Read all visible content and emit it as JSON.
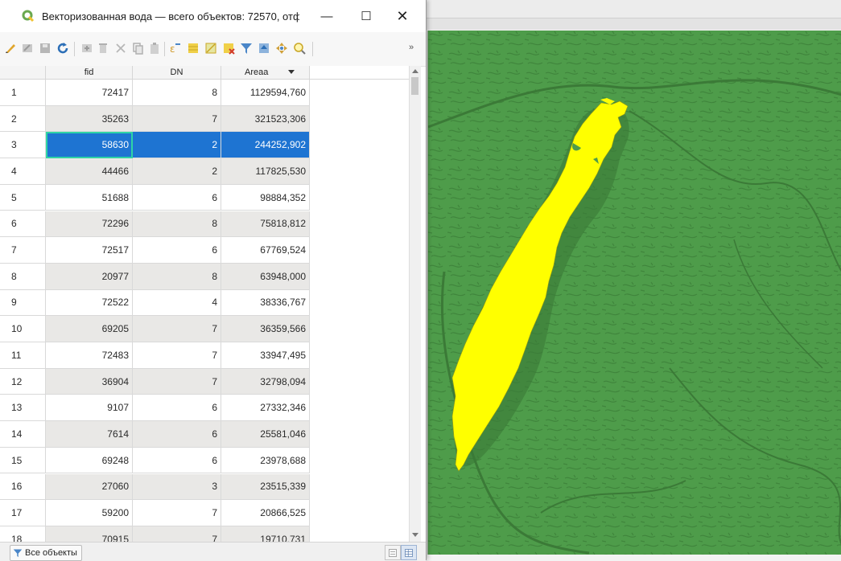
{
  "window": {
    "title": "Векторизованная вода — всего объектов: 72570, отф…",
    "buttons": {
      "minimize": "—",
      "maximize": "☐",
      "close": "✕"
    }
  },
  "toolbar": {
    "more": "»"
  },
  "table": {
    "columns": [
      "fid",
      "DN",
      "Areaa"
    ],
    "sort_column": "Areaa",
    "rows": [
      {
        "idx": "1",
        "fid": "72417",
        "dn": "8",
        "area": "1129594,760"
      },
      {
        "idx": "2",
        "fid": "35263",
        "dn": "7",
        "area": "321523,306"
      },
      {
        "idx": "3",
        "fid": "58630",
        "dn": "2",
        "area": "244252,902",
        "selected": true
      },
      {
        "idx": "4",
        "fid": "44466",
        "dn": "2",
        "area": "117825,530"
      },
      {
        "idx": "5",
        "fid": "51688",
        "dn": "6",
        "area": "98884,352"
      },
      {
        "idx": "6",
        "fid": "72296",
        "dn": "8",
        "area": "75818,812"
      },
      {
        "idx": "7",
        "fid": "72517",
        "dn": "6",
        "area": "67769,524"
      },
      {
        "idx": "8",
        "fid": "20977",
        "dn": "8",
        "area": "63948,000"
      },
      {
        "idx": "9",
        "fid": "72522",
        "dn": "4",
        "area": "38336,767"
      },
      {
        "idx": "10",
        "fid": "69205",
        "dn": "7",
        "area": "36359,566"
      },
      {
        "idx": "11",
        "fid": "72483",
        "dn": "7",
        "area": "33947,495"
      },
      {
        "idx": "12",
        "fid": "36904",
        "dn": "7",
        "area": "32798,094"
      },
      {
        "idx": "13",
        "fid": "9107",
        "dn": "6",
        "area": "27332,346"
      },
      {
        "idx": "14",
        "fid": "7614",
        "dn": "6",
        "area": "25581,046"
      },
      {
        "idx": "15",
        "fid": "69248",
        "dn": "6",
        "area": "23978,688"
      },
      {
        "idx": "16",
        "fid": "27060",
        "dn": "3",
        "area": "23515,339"
      },
      {
        "idx": "17",
        "fid": "59200",
        "dn": "7",
        "area": "20866,525"
      },
      {
        "idx": "18",
        "fid": "70915",
        "dn": "7",
        "area": "19710,731"
      }
    ]
  },
  "statusbar": {
    "filter_label": "Все объекты"
  },
  "colors": {
    "selected_row": "#1e74d2",
    "lake": "#ffff00",
    "land": "#4e9c4a"
  }
}
